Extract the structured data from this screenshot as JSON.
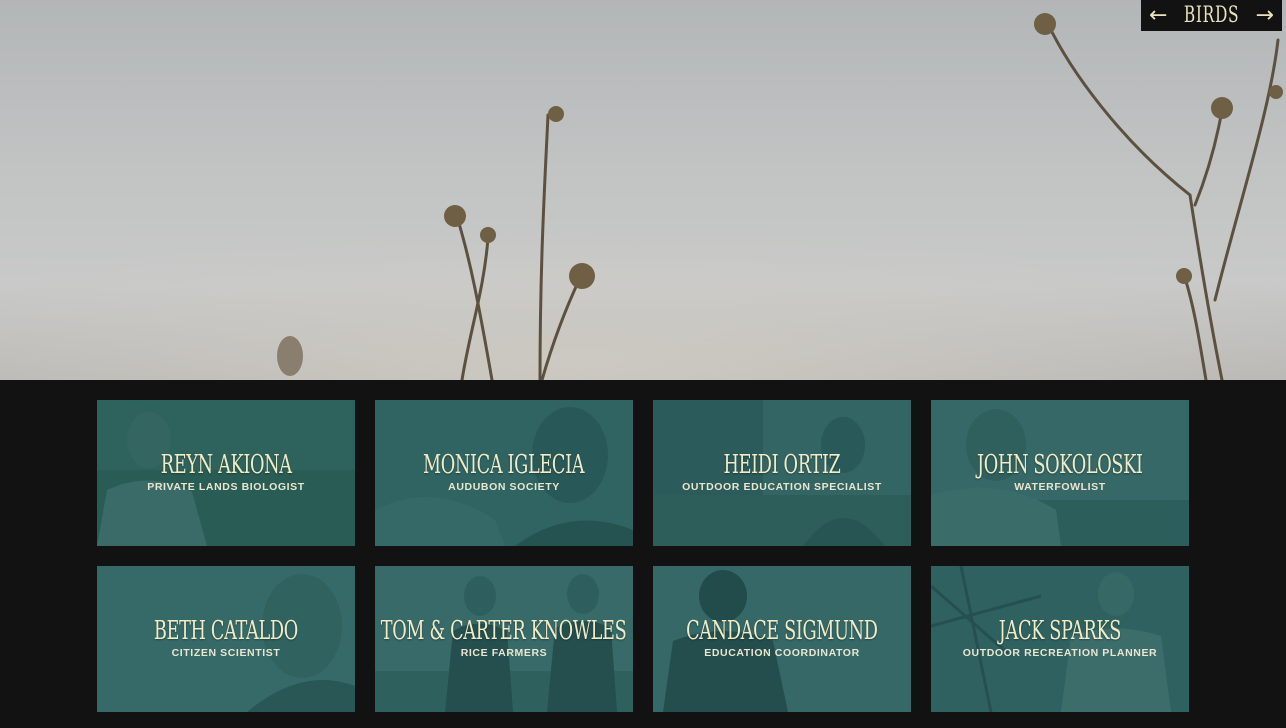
{
  "nav": {
    "prev_icon": "arrow-left-icon",
    "next_icon": "arrow-right-icon",
    "prev_glyph": "←",
    "next_glyph": "→",
    "section_label": "BIRDS"
  },
  "people": [
    {
      "name": "REYN AKIONA",
      "role": "PRIVATE LANDS BIOLOGIST"
    },
    {
      "name": "MONICA IGLECIA",
      "role": "AUDUBON SOCIETY"
    },
    {
      "name": "HEIDI ORTIZ",
      "role": "OUTDOOR EDUCATION SPECIALIST"
    },
    {
      "name": "JOHN SOKOLOSKI",
      "role": "WATERFOWLIST"
    },
    {
      "name": "BETH CATALDO",
      "role": "CITIZEN SCIENTIST"
    },
    {
      "name": "TOM & CARTER KNOWLES",
      "role": "RICE FARMERS"
    },
    {
      "name": "CANDACE SIGMUND",
      "role": "EDUCATION COORDINATOR"
    },
    {
      "name": "JACK SPARKS",
      "role": "OUTDOOR RECREATION PLANNER"
    }
  ],
  "colors": {
    "background": "#121212",
    "card_tint": "#245c5c",
    "text": "#f1ecc8"
  }
}
